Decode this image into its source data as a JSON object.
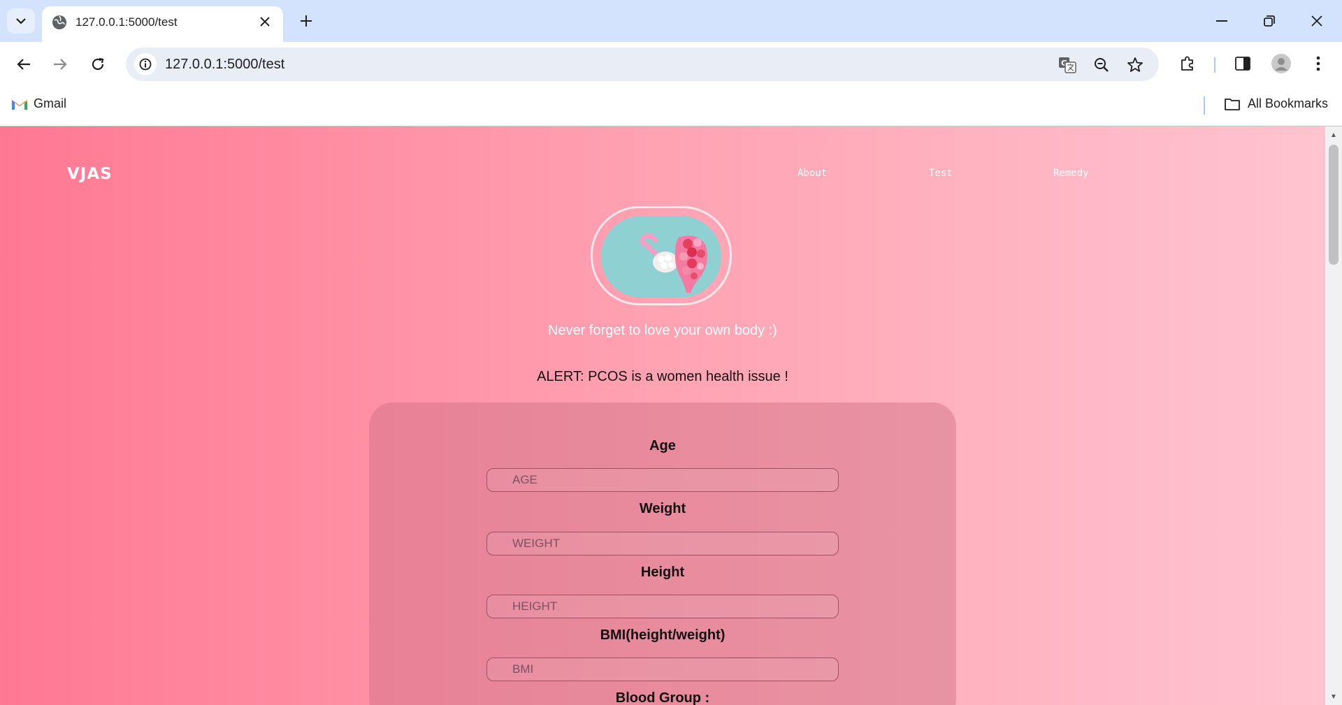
{
  "browser": {
    "tab_title": "127.0.0.1:5000/test",
    "url": "127.0.0.1:5000/test",
    "bookmarks": [
      {
        "label": "Gmail",
        "icon": "gmail-icon"
      }
    ],
    "all_bookmarks_label": "All Bookmarks"
  },
  "page": {
    "brand": "VJAS",
    "nav": [
      {
        "label": "About"
      },
      {
        "label": "Test"
      },
      {
        "label": "Remedy"
      }
    ],
    "tagline": "Never forget to love your own body :)",
    "alert": "ALERT: PCOS is a women health issue !",
    "form": {
      "fields": [
        {
          "label": "Age",
          "placeholder": "AGE",
          "value": ""
        },
        {
          "label": "Weight",
          "placeholder": "WEIGHT",
          "value": ""
        },
        {
          "label": "Height",
          "placeholder": "HEIGHT",
          "value": ""
        },
        {
          "label": "BMI(height/weight)",
          "placeholder": "BMI",
          "value": ""
        },
        {
          "label": "Blood Group :",
          "placeholder": "",
          "value": ""
        }
      ]
    }
  },
  "colors": {
    "gradient_start": "#ff7893",
    "gradient_end": "#ffc5d0",
    "tab_bar": "#d3e3fd",
    "omnibox": "#e9eef6"
  }
}
